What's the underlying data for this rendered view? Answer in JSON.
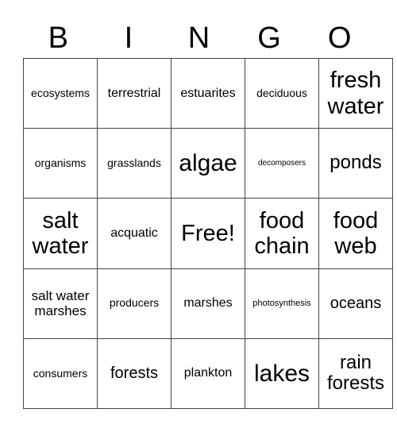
{
  "header": [
    "B",
    "I",
    "N",
    "G",
    "O"
  ],
  "rows": [
    [
      {
        "text": "ecosystems",
        "size": "s13"
      },
      {
        "text": "terrestrial",
        "size": "s16"
      },
      {
        "text": "estuarites",
        "size": "s16"
      },
      {
        "text": "deciduous",
        "size": "s13"
      },
      {
        "text": "fresh water",
        "size": "s28"
      }
    ],
    [
      {
        "text": "organisms",
        "size": "s13"
      },
      {
        "text": "grasslands",
        "size": "s13"
      },
      {
        "text": "algae",
        "size": "s30"
      },
      {
        "text": "decomposers",
        "size": "sm9"
      },
      {
        "text": "ponds",
        "size": "s24"
      }
    ],
    [
      {
        "text": "salt water",
        "size": "s28"
      },
      {
        "text": "acquatic",
        "size": "s16"
      },
      {
        "text": "Free!",
        "size": "s28"
      },
      {
        "text": "food chain",
        "size": "s28"
      },
      {
        "text": "food web",
        "size": "s28"
      }
    ],
    [
      {
        "text": "salt water marshes",
        "size": "s18"
      },
      {
        "text": "producers",
        "size": "s13"
      },
      {
        "text": "marshes",
        "size": "s16"
      },
      {
        "text": "photosynthesis",
        "size": "s10"
      },
      {
        "text": "oceans",
        "size": "s20"
      }
    ],
    [
      {
        "text": "consumers",
        "size": "s13"
      },
      {
        "text": "forests",
        "size": "s20"
      },
      {
        "text": "plankton",
        "size": "s16"
      },
      {
        "text": "lakes",
        "size": "s30"
      },
      {
        "text": "rain forests",
        "size": "s24"
      }
    ]
  ]
}
